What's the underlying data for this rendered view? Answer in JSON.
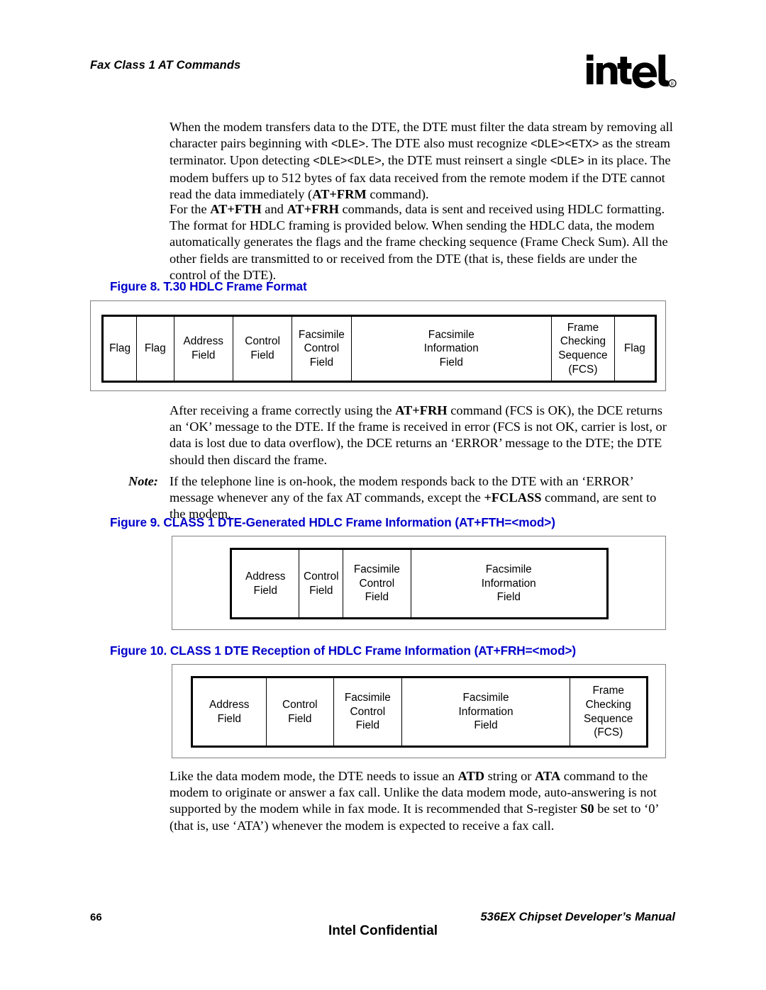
{
  "header": {
    "running_head": "Fax Class 1 AT Commands",
    "logo_name": "intel-logo",
    "logo_text": "intel",
    "logo_registered": "®"
  },
  "body": {
    "paragraph_1_html": "When the modem transfers data to the DTE, the DTE must filter the data stream by removing all character pairs beginning with <span class=\"mono\">&lt;DLE&gt;</span>. The DTE also must recognize <span class=\"mono\">&lt;DLE&gt;&lt;ETX&gt;</span> as the stream terminator. Upon detecting <span class=\"mono\">&lt;DLE&gt;&lt;DLE&gt;</span>, the DTE must reinsert a single <span class=\"mono\">&lt;DLE&gt;</span> in its place. The modem buffers up to 512 bytes of fax data received from the remote modem if the DTE cannot read the data immediately (<b>AT+FRM</b> command).",
    "paragraph_1_text": "When the modem transfers data to the DTE, the DTE must filter the data stream by removing all character pairs beginning with <DLE>. The DTE also must recognize <DLE><ETX> as the stream terminator. Upon detecting <DLE><DLE>, the DTE must reinsert a single <DLE> in its place. The modem buffers up to 512 bytes of fax data received from the remote modem if the DTE cannot read the data immediately (AT+FRM command).",
    "paragraph_2_html": "For the <b>AT+FTH</b> and <b>AT+FRH</b> commands, data is sent and received using HDLC formatting. The format for HDLC framing is provided below. When sending the HDLC data, the modem automatically generates the flags and the frame checking sequence (Frame Check Sum). All the other fields are transmitted to or received from the DTE (that is, these fields are under the control of the DTE).",
    "paragraph_3_html": "After receiving a frame correctly using the <b>AT+FRH</b> command (FCS is OK), the DCE returns an &lsquo;OK&rsquo; message to the DTE. If the frame is received in error (FCS is not OK, carrier is lost, or data is lost due to data overflow), the DCE returns an &lsquo;ERROR&rsquo; message to the DTE; the DTE should then discard the frame.",
    "note_label": "Note:",
    "note_html": "If the telephone line is on-hook, the modem responds back to the DTE with an &lsquo;ERROR&rsquo; message whenever any of the fax AT commands, except the <b>+FCLASS</b> command, are sent to the modem.",
    "paragraph_4_html": "Like the data modem mode, the DTE needs to issue an <b>ATD</b> string or <b>ATA</b> command to the modem to originate or answer a fax call. Unlike the data modem mode, auto-answering is not supported by the modem while in fax mode. It is recommended that S-register <b>S0</b> be set to &lsquo;0&rsquo; (that is, use &lsquo;ATA&rsquo;) whenever the modem is expected to receive a fax call."
  },
  "figures": [
    {
      "number": "Figure 8.",
      "title": "T.30 HDLC Frame Format",
      "caption": "Figure 8.  T.30 HDLC Frame Format",
      "caption_color": "#0000CC",
      "cells": [
        {
          "lines": [
            "Flag"
          ]
        },
        {
          "lines": [
            "Flag"
          ]
        },
        {
          "lines": [
            "Address",
            "Field"
          ]
        },
        {
          "lines": [
            "Control",
            "Field"
          ]
        },
        {
          "lines": [
            "Facsimile",
            "Control",
            "Field"
          ]
        },
        {
          "lines": [
            "Facsimile",
            "Information",
            "Field"
          ]
        },
        {
          "lines": [
            "Frame",
            "Checking",
            "Sequence",
            "(FCS)"
          ]
        },
        {
          "lines": [
            "Flag"
          ]
        }
      ]
    },
    {
      "number": "Figure 9.",
      "title": "CLASS 1 DTE-Generated HDLC Frame Information (AT+FTH=<mod>)",
      "caption": "Figure 9.  CLASS 1 DTE-Generated HDLC Frame Information (AT+FTH=<mod>)",
      "caption_color": "#0000CC",
      "cells": [
        {
          "lines": [
            "Address",
            "Field"
          ]
        },
        {
          "lines": [
            "Control",
            "Field"
          ]
        },
        {
          "lines": [
            "Facsimile",
            "Control",
            "Field"
          ]
        },
        {
          "lines": [
            "Facsimile",
            "Information",
            "Field"
          ]
        }
      ]
    },
    {
      "number": "Figure 10.",
      "title": "CLASS 1 DTE Reception of HDLC Frame Information (AT+FRH=<mod>)",
      "caption": "Figure 10. CLASS 1 DTE Reception of HDLC Frame Information (AT+FRH=<mod>)",
      "caption_color": "#0000CC",
      "cells": [
        {
          "lines": [
            "Address",
            "Field"
          ]
        },
        {
          "lines": [
            "Control",
            "Field"
          ]
        },
        {
          "lines": [
            "Facsimile",
            "Control",
            "Field"
          ]
        },
        {
          "lines": [
            "Facsimile",
            "Information",
            "Field"
          ]
        },
        {
          "lines": [
            "Frame",
            "Checking",
            "Sequence",
            "(FCS)"
          ]
        }
      ]
    }
  ],
  "footer": {
    "page_number": "66",
    "manual_title": "536EX Chipset Developer’s Manual",
    "confidential": "Intel Confidential"
  }
}
